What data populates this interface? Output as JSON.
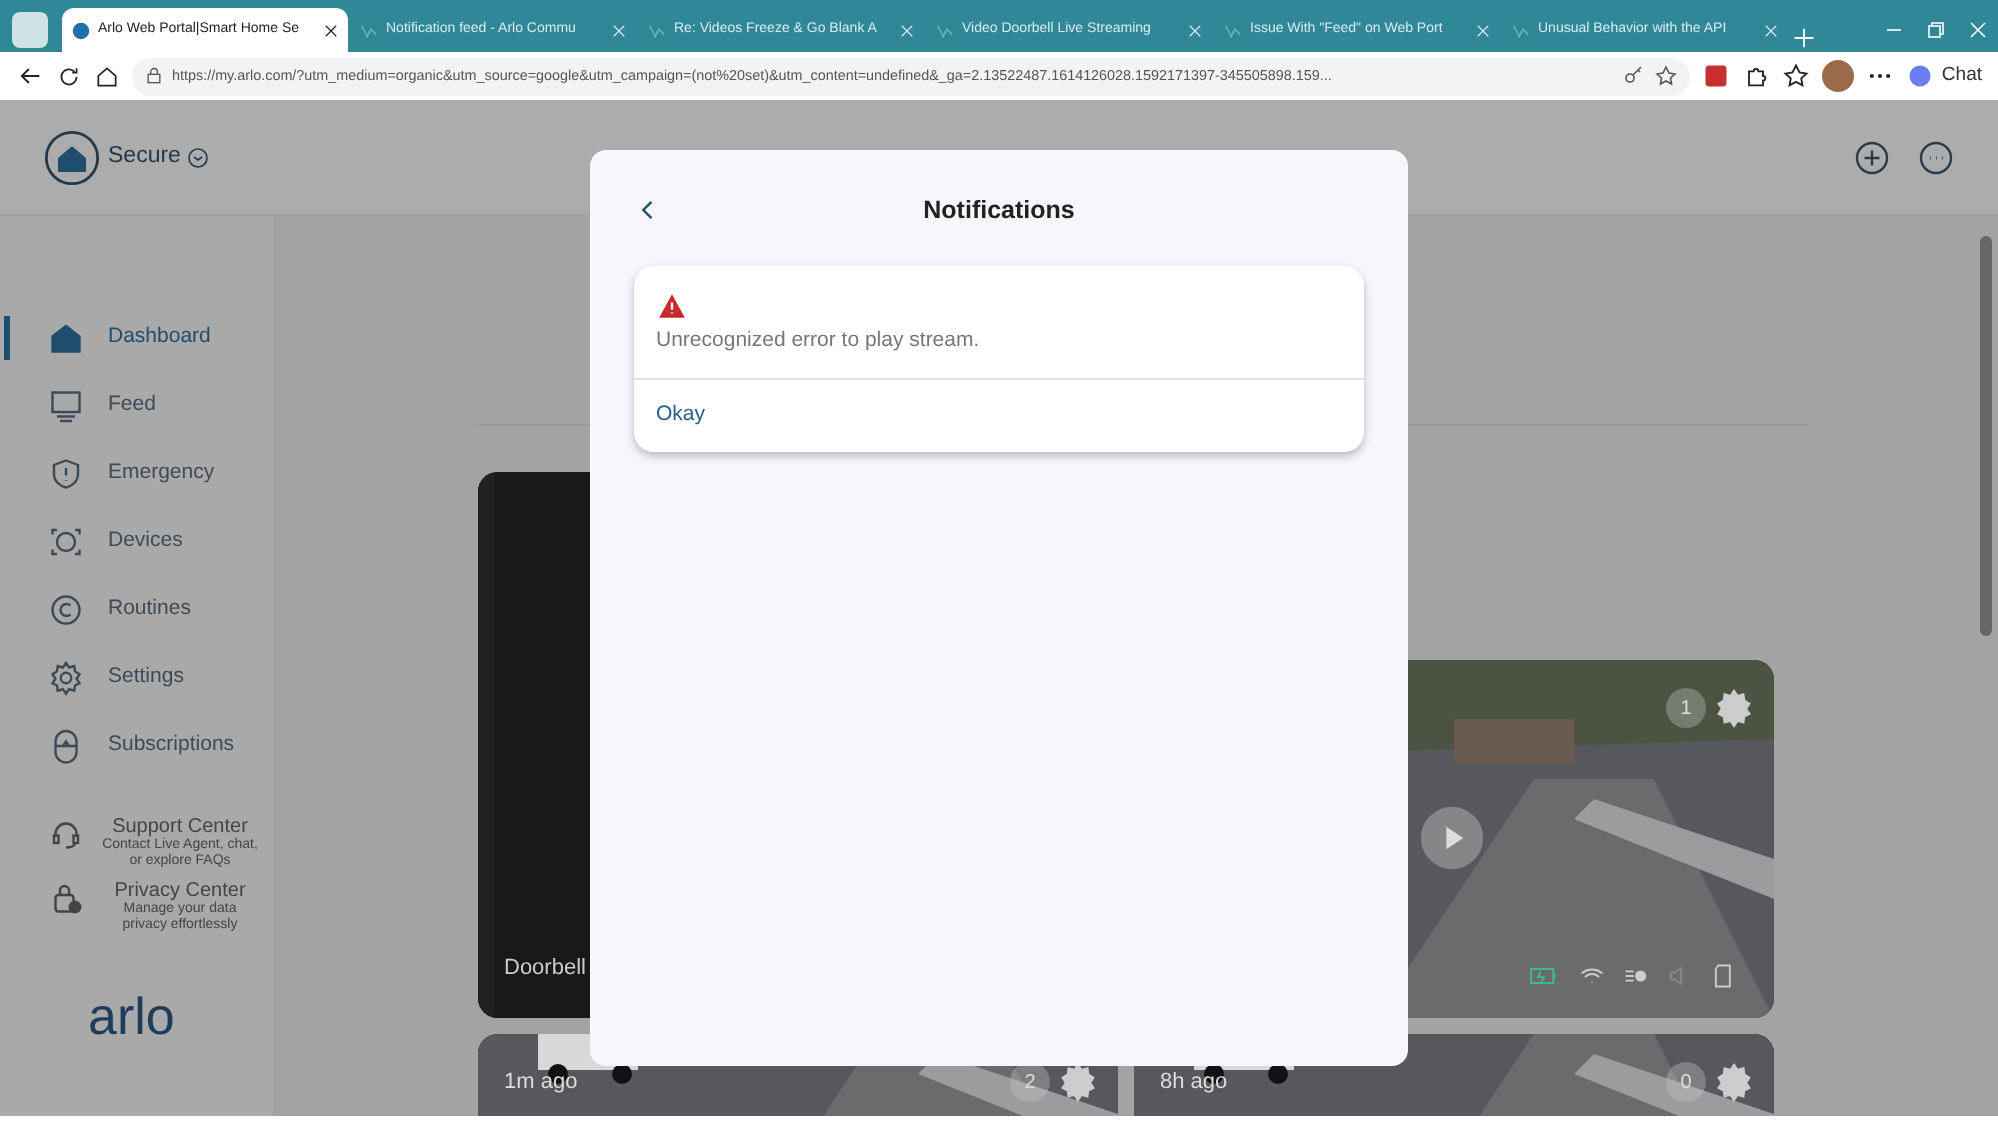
{
  "browser": {
    "tabs": [
      {
        "label": "Arlo Web Portal|Smart Home Se",
        "selected": true
      },
      {
        "label": "Notification feed - Arlo Commu",
        "selected": false
      },
      {
        "label": "Re: Videos Freeze & Go Blank A",
        "selected": false
      },
      {
        "label": "Video Doorbell Live Streaming",
        "selected": false
      },
      {
        "label": "Issue With \"Feed\" on Web Port",
        "selected": false
      },
      {
        "label": "Unusual Behavior with the API",
        "selected": false
      }
    ],
    "url": "https://my.arlo.com/?utm_medium=organic&utm_source=google&utm_campaign=(not%20set)&utm_content=undefined&_ga=2.13522487.1614126028.1592171397-345505898.159...",
    "chat_label": "Chat"
  },
  "header": {
    "mode": "Secure"
  },
  "sidebar": {
    "items": [
      {
        "label": "Dashboard",
        "selected": true
      },
      {
        "label": "Feed",
        "selected": false
      },
      {
        "label": "Emergency",
        "selected": false
      },
      {
        "label": "Devices",
        "selected": false
      },
      {
        "label": "Routines",
        "selected": false
      },
      {
        "label": "Settings",
        "selected": false
      },
      {
        "label": "Subscriptions",
        "selected": false
      }
    ],
    "help": [
      {
        "title": "Support Center",
        "subtitle": "Contact Live Agent, chat, or explore FAQs"
      },
      {
        "title": "Privacy Center",
        "subtitle": "Manage your data privacy effortlessly"
      }
    ],
    "logo": "arlo"
  },
  "devices": [
    {
      "kind": "doorbell",
      "label": "Doorbell"
    },
    {
      "kind": "camera",
      "count": "1"
    },
    {
      "kind": "clip",
      "time": "1m ago",
      "count": "2"
    },
    {
      "kind": "clip",
      "time": "8h ago",
      "count": "0"
    }
  ],
  "modal": {
    "title": "Notifications",
    "message": "Unrecognized error to play stream.",
    "action": "Okay"
  }
}
